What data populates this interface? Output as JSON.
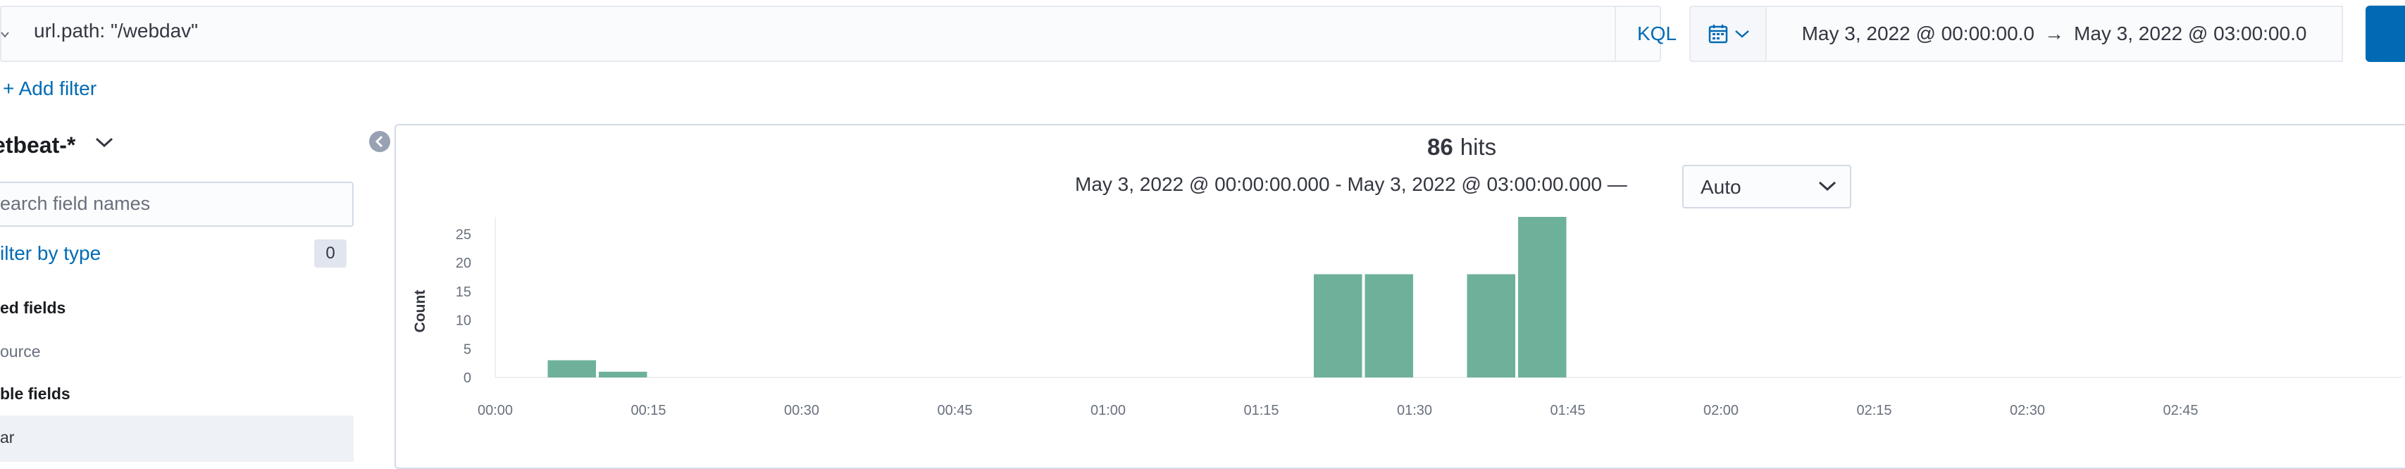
{
  "query": {
    "text": "url.path: \"/webdav\"",
    "language": "KQL"
  },
  "time_picker": {
    "start": "May 3, 2022 @ 00:00:00.0",
    "arrow": "→",
    "end": "May 3, 2022 @ 03:00:00.0"
  },
  "filters": {
    "add_label": "+ Add filter"
  },
  "sidebar": {
    "index_pattern": "etbeat-*",
    "search_placeholder": "earch field names",
    "filter_by_type": "ilter by type",
    "filter_count": "0",
    "selected_heading": "ed fields",
    "selected_fields": [
      "ource"
    ],
    "available_heading": "ble fields",
    "available_fields": [
      "ar"
    ]
  },
  "main": {
    "hits_count": "86",
    "hits_label": "hits",
    "time_range": "May 3, 2022 @ 00:00:00.000 - May 3, 2022 @ 03:00:00.000 —",
    "interval": "Auto"
  },
  "colors": {
    "accent": "#006bb4",
    "bar": "#6eb19a"
  },
  "icons": [
    "chevron-down-icon",
    "calendar-icon",
    "arrow-right-icon",
    "collapse-left-icon",
    "refresh-icon"
  ],
  "chart_data": {
    "type": "bar",
    "xlabel": "",
    "ylabel": "Count",
    "ylim": [
      0,
      28
    ],
    "yticks": [
      0,
      5,
      10,
      15,
      20,
      25
    ],
    "x_tick_labels": [
      "00:00",
      "00:15",
      "00:30",
      "00:45",
      "01:00",
      "01:15",
      "01:30",
      "01:45",
      "02:00",
      "02:15",
      "02:30",
      "02:45"
    ],
    "bars": [
      {
        "start": "00:05",
        "end": "00:10",
        "value": 3
      },
      {
        "start": "00:10",
        "end": "00:15",
        "value": 1
      },
      {
        "start": "01:20",
        "end": "01:25",
        "value": 18
      },
      {
        "start": "01:25",
        "end": "01:30",
        "value": 18
      },
      {
        "start": "01:35",
        "end": "01:40",
        "value": 18
      },
      {
        "start": "01:40",
        "end": "01:45",
        "value": 28
      }
    ]
  }
}
